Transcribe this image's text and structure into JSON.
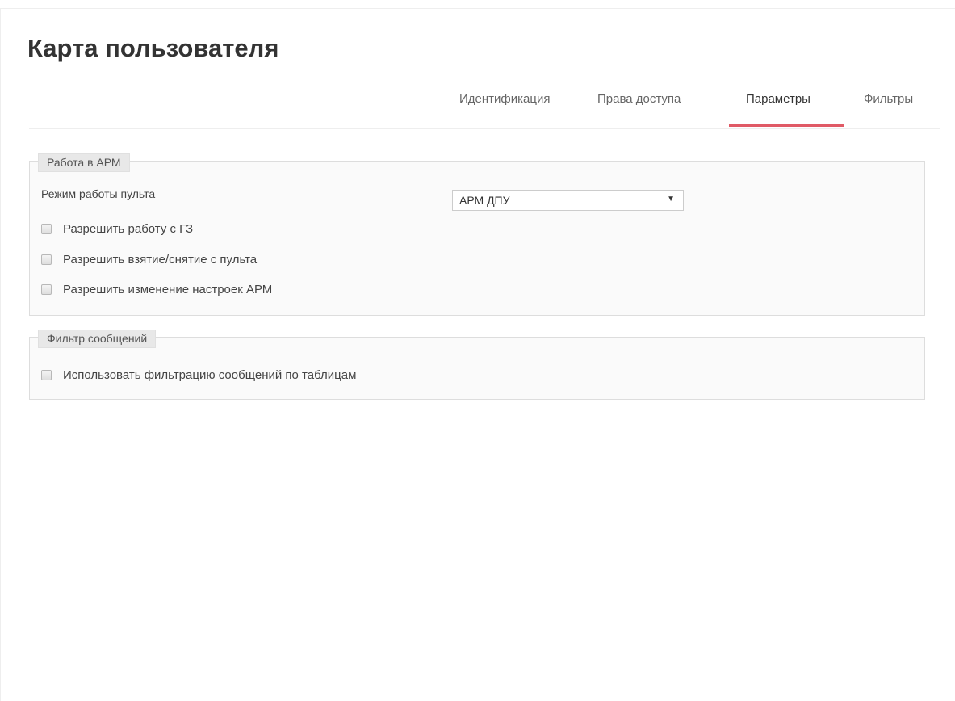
{
  "page": {
    "title": "Карта пользователя"
  },
  "tabs": [
    {
      "label": "Идентификация",
      "active": false
    },
    {
      "label": "Права доступа",
      "active": false
    },
    {
      "label": "Параметры",
      "active": true
    },
    {
      "label": "Фильтры",
      "active": false
    }
  ],
  "colors": {
    "active_tab_underline": "#e05a66"
  },
  "arm_section": {
    "legend": "Работа в АРМ",
    "mode_label": "Режим работы пульта",
    "mode_select": {
      "selected": "АРМ ДПУ",
      "arrow_icon": "triangle-down-icon"
    },
    "checkboxes": [
      {
        "label": "Разрешить работу с ГЗ",
        "checked": false
      },
      {
        "label": "Разрешить взятие/снятие с пульта",
        "checked": false
      },
      {
        "label": "Разрешить изменение настроек АРМ",
        "checked": false
      }
    ]
  },
  "filter_section": {
    "legend": "Фильтр сообщений",
    "checkboxes": [
      {
        "label": "Использовать фильтрацию сообщений по таблицам",
        "checked": false
      }
    ]
  }
}
